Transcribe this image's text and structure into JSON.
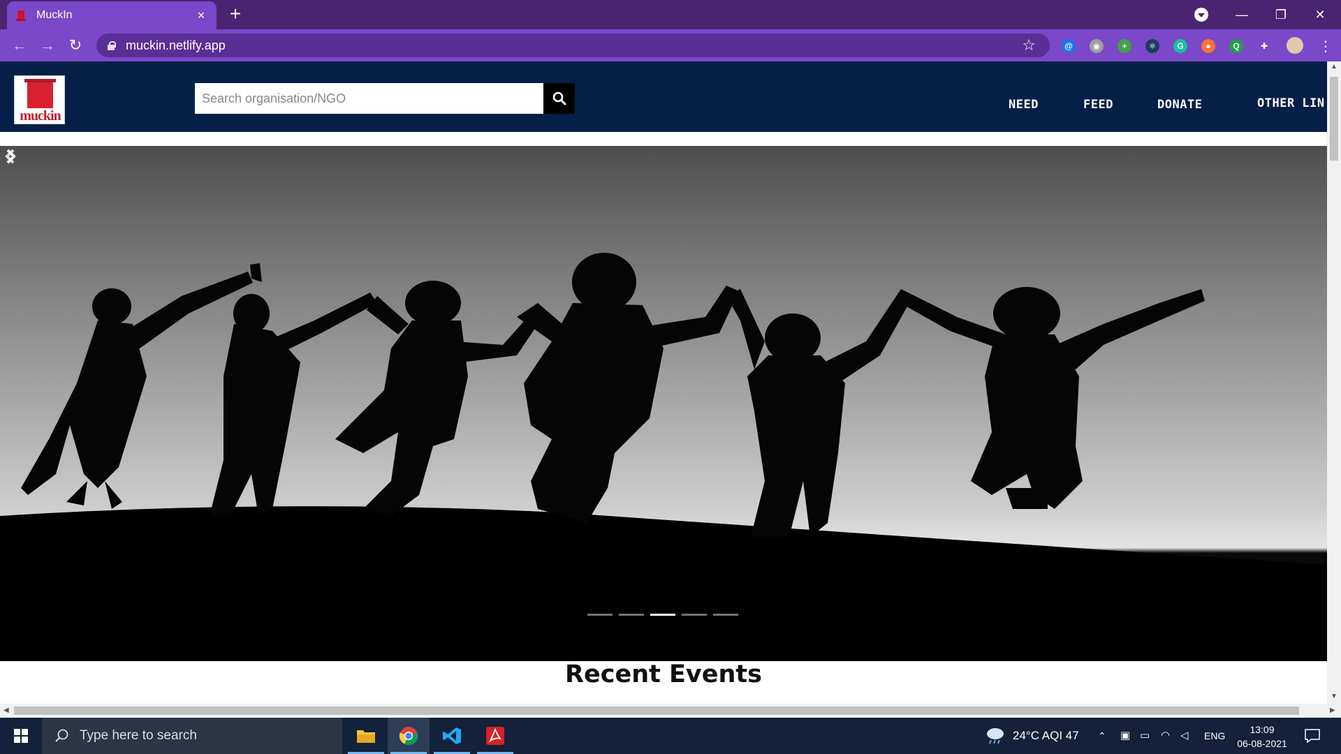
{
  "browser": {
    "tab_title": "MuckIn",
    "tab_close": "×",
    "new_tab": "+",
    "url": "muckin.netlify.app",
    "window_controls": {
      "minimize": "—",
      "restore": "❐",
      "close": "✕"
    },
    "extensions": [
      {
        "name": "a-icon",
        "label": "@",
        "color": "#1a73e8"
      },
      {
        "name": "camera-icon",
        "label": "◉",
        "color": "#9e9e9e"
      },
      {
        "name": "plus-extension-icon",
        "label": "+",
        "color": "#43a047"
      },
      {
        "name": "react-icon",
        "label": "⚛",
        "color": "#1e3a5f"
      },
      {
        "name": "grammarly-icon",
        "label": "G",
        "color": "#15c39a"
      },
      {
        "name": "firefox-relay-icon",
        "label": "●",
        "color": "#ff7139"
      },
      {
        "name": "q-icon",
        "label": "Q",
        "color": "#1fa04a"
      },
      {
        "name": "puzzle-icon",
        "label": "✚",
        "color": "#7a48c8"
      }
    ]
  },
  "site": {
    "logo_text": "muckin",
    "search_placeholder": "Search organisation/NGO",
    "nav": [
      "NEED",
      "FEED",
      "DONATE",
      "OTHER LIN"
    ],
    "carousel": {
      "slides": 5,
      "active_index": 2
    },
    "section_title": "Recent Events"
  },
  "taskbar": {
    "search_placeholder": "Type here to search",
    "weather": "24°C  AQI 47",
    "language": "ENG",
    "time": "13:09",
    "date": "06-08-2021"
  }
}
